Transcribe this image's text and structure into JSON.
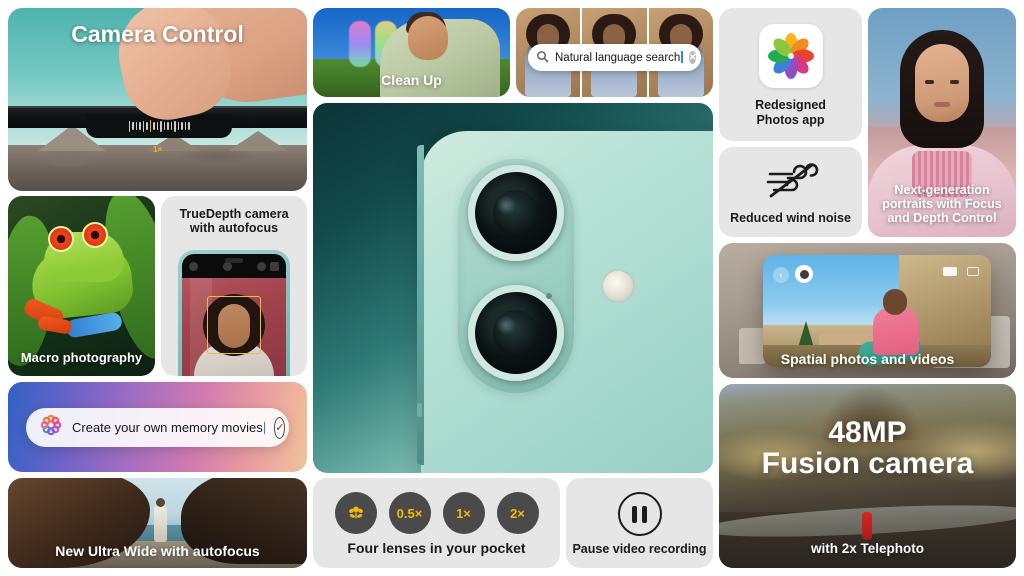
{
  "page": {
    "background": "#ffffff"
  },
  "tiles": {
    "camera_control": {
      "title": "Camera Control",
      "zoom_label": "1×"
    },
    "clean_up": {
      "caption": "Clean Up"
    },
    "search": {
      "query": "Natural language search",
      "search_icon": "magnifier-icon",
      "clear_icon": "clear-circle-icon"
    },
    "photos_app": {
      "caption_line1": "Redesigned",
      "caption_line2": "Photos app",
      "icon": "photos-app-icon"
    },
    "wind_noise": {
      "caption": "Reduced wind noise",
      "icon": "wind-slash-icon"
    },
    "portraits": {
      "caption_line1": "Next-generation",
      "caption_line2": "portraits with Focus",
      "caption_line3": "and Depth Control"
    },
    "macro": {
      "caption": "Macro photography"
    },
    "truedepth": {
      "caption_line1": "TrueDepth camera",
      "caption_line2": "with autofocus"
    },
    "hero_phone": {
      "alt": "iPhone rear dual camera in teal"
    },
    "spatial": {
      "caption": "Spatial photos and videos"
    },
    "memory": {
      "text": "Create your own memory movies",
      "leading_icon": "apple-intelligence-icon",
      "confirm_icon": "check-circle-icon"
    },
    "ultra_wide": {
      "caption": "New Ultra Wide with autofocus"
    },
    "lenses": {
      "caption": "Four lenses in your pocket",
      "chips": [
        {
          "name": "macro-flower-icon",
          "label": ""
        },
        {
          "name": "zoom-0-5x",
          "label": "0.5×"
        },
        {
          "name": "zoom-1x",
          "label": "1×"
        },
        {
          "name": "zoom-2x",
          "label": "2×"
        }
      ]
    },
    "pause": {
      "caption": "Pause video recording",
      "icon": "pause-circle-icon"
    },
    "fusion": {
      "headline_line1": "48MP",
      "headline_line2": "Fusion camera",
      "subtitle": "with 2x Telephoto"
    }
  },
  "colors": {
    "tile_grey": "#e6e6e6",
    "chip_dark": "#4a4a4a",
    "chip_amber": "#f2b90c",
    "caret_blue": "#2f7ff0",
    "hero_teal_dark": "#0d3336",
    "hero_mint": "#b8e2d6"
  }
}
